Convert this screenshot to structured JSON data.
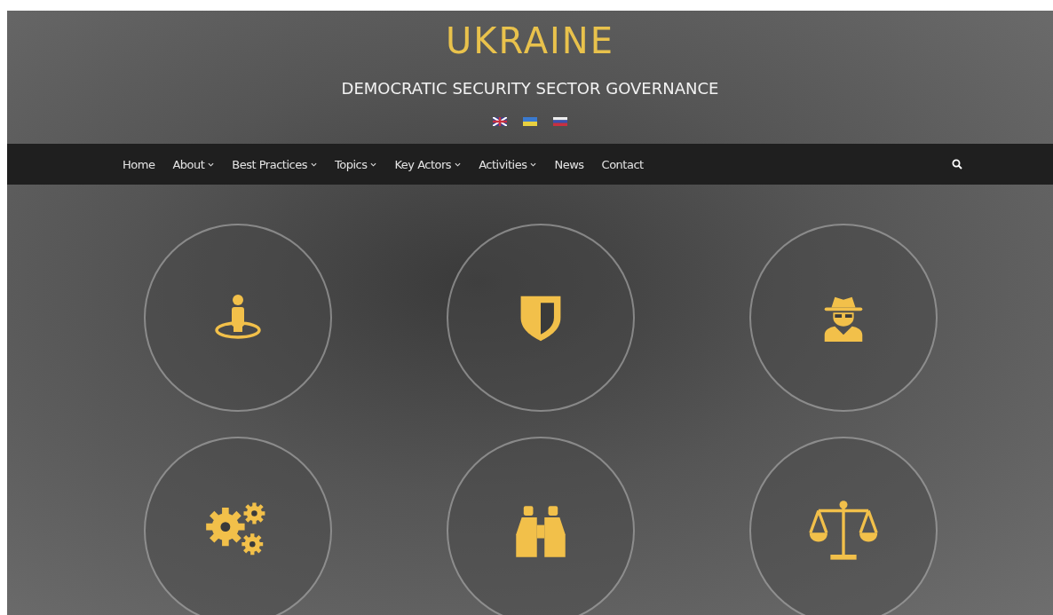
{
  "site": {
    "title": "UKRAINE",
    "subtitle": "DEMOCRATIC SECURITY SECTOR GOVERNANCE"
  },
  "nav": [
    {
      "label": "Home",
      "has_dropdown": false
    },
    {
      "label": "About",
      "has_dropdown": true
    },
    {
      "label": "Best Practices",
      "has_dropdown": true
    },
    {
      "label": "Topics",
      "has_dropdown": true
    },
    {
      "label": "Key Actors",
      "has_dropdown": true
    },
    {
      "label": "Activities",
      "has_dropdown": true
    },
    {
      "label": "News",
      "has_dropdown": false
    },
    {
      "label": "Contact",
      "has_dropdown": false
    }
  ]
}
